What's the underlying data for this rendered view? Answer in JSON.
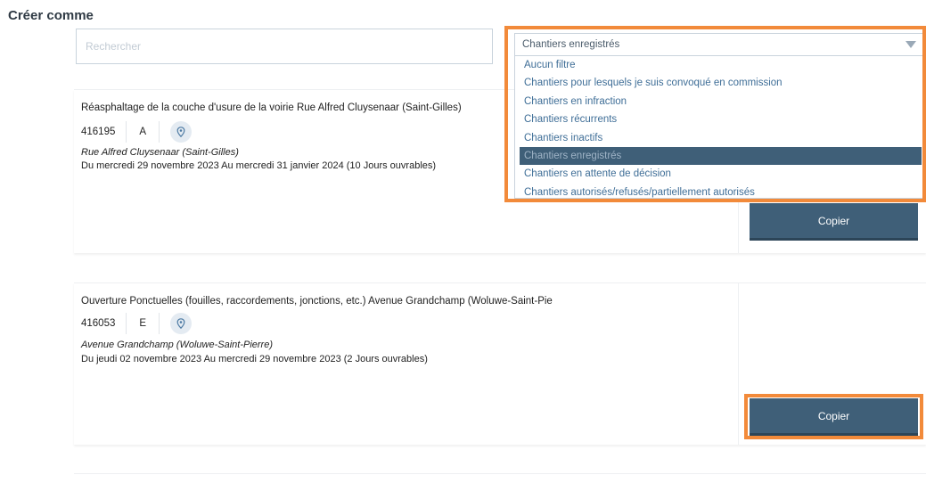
{
  "page": {
    "title": "Créer comme"
  },
  "search": {
    "placeholder": "Rechercher",
    "value": ""
  },
  "filter": {
    "selected": "Chantiers enregistrés",
    "options": [
      "Aucun filtre",
      "Chantiers pour lesquels je suis convoqué en commission",
      "Chantiers en infraction",
      "Chantiers récurrents",
      "Chantiers inactifs",
      "Chantiers enregistrés",
      "Chantiers en attente de décision",
      "Chantiers autorisés/refusés/partiellement autorisés"
    ],
    "selected_index": 5
  },
  "worksites": [
    {
      "name": "Réasphaltage de la couche d'usure de la voirie Rue Alfred Cluysenaar (Saint-Gilles)",
      "id": "416195",
      "category": "A",
      "street": "Rue Alfred Cluysenaar (Saint-Gilles)",
      "dates": "Du mercredi 29 novembre 2023 Au mercredi 31 janvier 2024 (10 Jours ouvrables)",
      "copy_label": "Copier"
    },
    {
      "name": "Ouverture Ponctuelles (fouilles, raccordements, jonctions, etc.) Avenue Grandchamp (Woluwe-Saint-Pie",
      "id": "416053",
      "category": "E",
      "street": "Avenue Grandchamp (Woluwe-Saint-Pierre)",
      "dates": "Du jeudi 02 novembre 2023 Au mercredi 29 novembre 2023 (2 Jours ouvrables)",
      "copy_label": "Copier"
    }
  ],
  "icons": {
    "location": "map-pin-icon",
    "dropdown": "triangle-down-icon"
  },
  "colors": {
    "button": "#3f5f78",
    "highlight": "#f28a3a",
    "option_text": "#3f6e97"
  }
}
